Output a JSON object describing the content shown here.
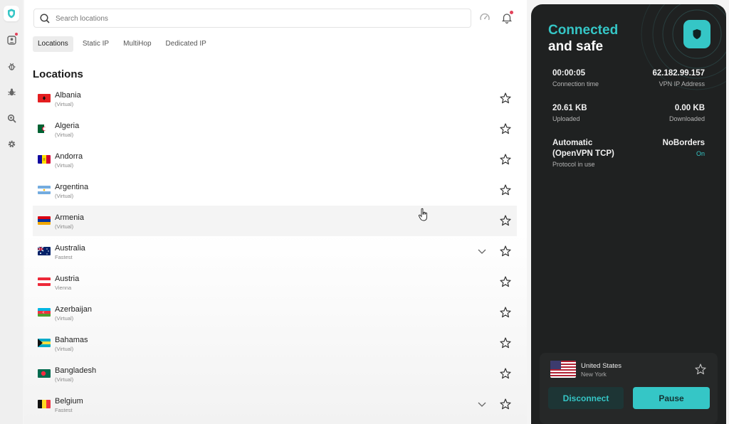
{
  "search": {
    "placeholder": "Search locations"
  },
  "tabs": [
    {
      "label": "Locations",
      "active": true
    },
    {
      "label": "Static IP"
    },
    {
      "label": "MultiHop"
    },
    {
      "label": "Dedicated IP"
    }
  ],
  "section_title": "Locations",
  "locations": [
    {
      "name": "Albania",
      "sub": "(Virtual)",
      "flag": "albania-flag-icon"
    },
    {
      "name": "Algeria",
      "sub": "(Virtual)",
      "flag": "algeria-flag-icon"
    },
    {
      "name": "Andorra",
      "sub": "(Virtual)",
      "flag": "andorra-flag-icon"
    },
    {
      "name": "Argentina",
      "sub": "(Virtual)",
      "flag": "argentina-flag-icon"
    },
    {
      "name": "Armenia",
      "sub": "(Virtual)",
      "flag": "armenia-flag-icon"
    },
    {
      "name": "Australia",
      "sub": "Fastest",
      "flag": "australia-flag-icon",
      "expandable": true
    },
    {
      "name": "Austria",
      "sub": "Vienna",
      "flag": "austria-flag-icon"
    },
    {
      "name": "Azerbaijan",
      "sub": "(Virtual)",
      "flag": "azerbaijan-flag-icon"
    },
    {
      "name": "Bahamas",
      "sub": "(Virtual)",
      "flag": "bahamas-flag-icon"
    },
    {
      "name": "Bangladesh",
      "sub": "(Virtual)",
      "flag": "bangladesh-flag-icon"
    },
    {
      "name": "Belgium",
      "sub": "Fastest",
      "flag": "belgium-flag-icon",
      "expandable": true
    }
  ],
  "panel": {
    "status_line1": "Connected",
    "status_line2": "and safe",
    "connection_time": {
      "value": "00:00:05",
      "label": "Connection time"
    },
    "vpn_ip": {
      "value": "62.182.99.157",
      "label": "VPN IP Address"
    },
    "uploaded": {
      "value": "20.61 KB",
      "label": "Uploaded"
    },
    "downloaded": {
      "value": "0.00 KB",
      "label": "Downloaded"
    },
    "protocol": {
      "value_line1": "Automatic",
      "value_line2": "(OpenVPN TCP)",
      "label": "Protocol in use"
    },
    "noborders": {
      "value": "NoBorders",
      "state": "On"
    },
    "current_location": {
      "country": "United States",
      "city": "New York"
    },
    "disconnect_label": "Disconnect",
    "pause_label": "Pause"
  },
  "colors": {
    "accent": "#35c6c6",
    "panel_bg": "#1f2121",
    "notification": "#e2425a"
  }
}
